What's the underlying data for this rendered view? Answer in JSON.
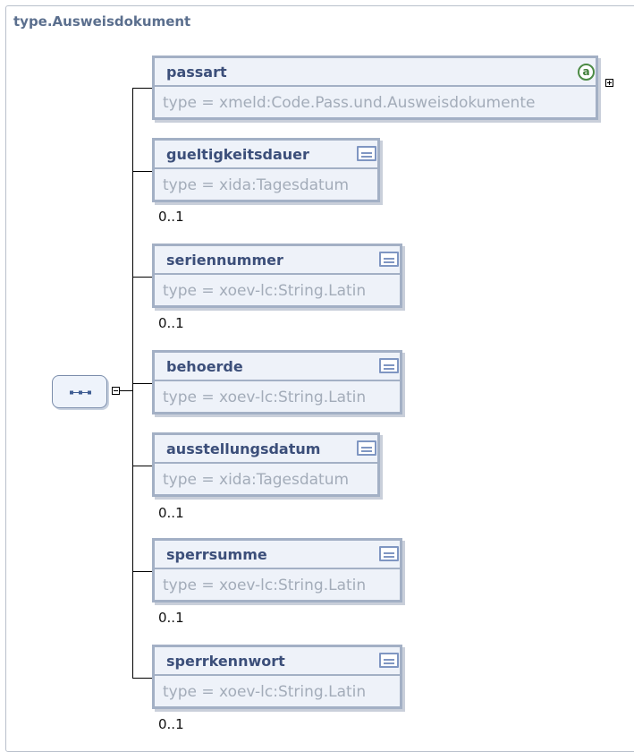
{
  "diagram": {
    "title": "type.Ausweisdokument",
    "sequence_icon": "sequence-compositor-icon",
    "elements": [
      {
        "name": "passart",
        "type": "type = xmeld:Code.Pass.und.Ausweisdokumente",
        "occurrence": "",
        "icon": "attribute-icon",
        "expandable": true
      },
      {
        "name": "gueltigkeitsdauer",
        "type": "type = xida:Tagesdatum",
        "occurrence": "0..1",
        "icon": "documentation-icon"
      },
      {
        "name": "seriennummer",
        "type": "type = xoev-lc:String.Latin",
        "occurrence": "0..1",
        "icon": "documentation-icon"
      },
      {
        "name": "behoerde",
        "type": "type = xoev-lc:String.Latin",
        "occurrence": "",
        "icon": "documentation-icon"
      },
      {
        "name": "ausstellungsdatum",
        "type": "type = xida:Tagesdatum",
        "occurrence": "0..1",
        "icon": "documentation-icon"
      },
      {
        "name": "sperrsumme",
        "type": "type = xoev-lc:String.Latin",
        "occurrence": "0..1",
        "icon": "documentation-icon"
      },
      {
        "name": "sperrkennwort",
        "type": "type = xoev-lc:String.Latin",
        "occurrence": "0..1",
        "icon": "documentation-icon"
      }
    ]
  }
}
